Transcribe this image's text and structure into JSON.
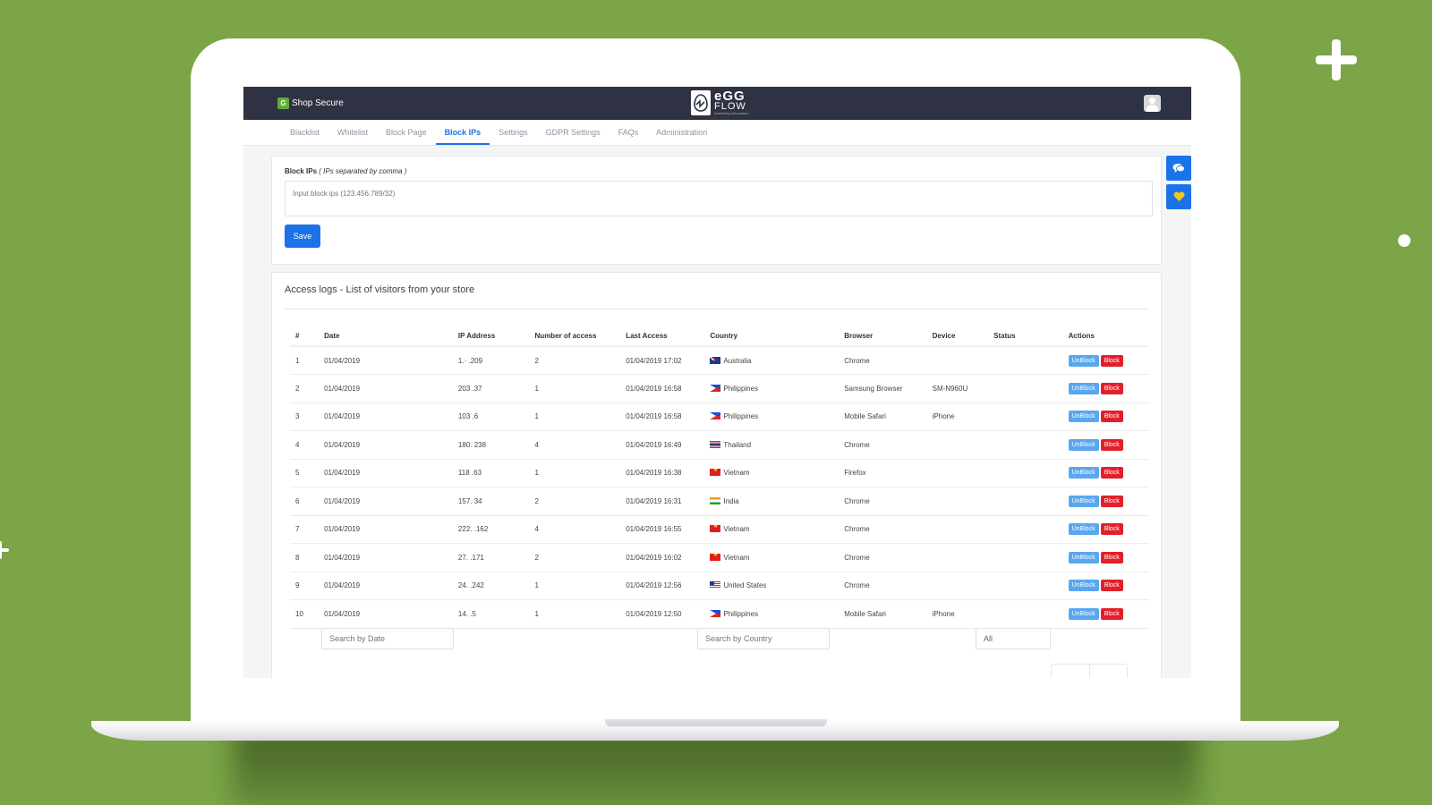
{
  "app": {
    "brand_name": "Shop Secure",
    "brand_icon": "shield-icon",
    "partner_logo": {
      "line1": "eGG",
      "line2": "FLOW",
      "tagline": "marketing automation"
    },
    "user_icon": "user-avatar-icon"
  },
  "tabs": [
    {
      "label": "Blacklist",
      "active": false
    },
    {
      "label": "Whitelist",
      "active": false
    },
    {
      "label": "Block Page",
      "active": false
    },
    {
      "label": "Block IPs",
      "active": true
    },
    {
      "label": "Settings",
      "active": false
    },
    {
      "label": "GDPR Settings",
      "active": false
    },
    {
      "label": "FAQs",
      "active": false
    },
    {
      "label": "Administration",
      "active": false
    }
  ],
  "side_buttons": [
    {
      "icon": "chat-icon"
    },
    {
      "icon": "heart-icon",
      "color": "#f5c518"
    }
  ],
  "block_form": {
    "label": "Block IPs",
    "hint": "( IPs separated by comma )",
    "placeholder": "Input block ips (123.456.789/32)",
    "value": "",
    "save_label": "Save"
  },
  "access_logs": {
    "title": "Access logs - List of visitors from your store",
    "columns": [
      "#",
      "Date",
      "IP Address",
      "Number of access",
      "Last Access",
      "Country",
      "Browser",
      "Device",
      "Status",
      "Actions"
    ],
    "rows": [
      {
        "n": "1",
        "date": "01/04/2019",
        "ip": "1.·      .209",
        "count": "2",
        "last": "01/04/2019 17:02",
        "flag": "au",
        "country": "Australia",
        "browser": "Chrome",
        "device": "",
        "status": ""
      },
      {
        "n": "2",
        "date": "01/04/2019",
        "ip": "203        .37",
        "count": "1",
        "last": "01/04/2019 16:58",
        "flag": "ph",
        "country": "Philippines",
        "browser": "Samsung Browser",
        "device": "SM-N960U",
        "status": ""
      },
      {
        "n": "3",
        "date": "01/04/2019",
        "ip": "103       .6",
        "count": "1",
        "last": "01/04/2019 16:58",
        "flag": "ph",
        "country": "Philippines",
        "browser": "Mobile Safari",
        "device": "iPhone",
        "status": ""
      },
      {
        "n": "4",
        "date": "01/04/2019",
        "ip": "180.        238",
        "count": "4",
        "last": "01/04/2019 16:49",
        "flag": "th",
        "country": "Thailand",
        "browser": "Chrome",
        "device": "",
        "status": ""
      },
      {
        "n": "5",
        "date": "01/04/2019",
        "ip": "118       .63",
        "count": "1",
        "last": "01/04/2019 16:38",
        "flag": "vn",
        "country": "Vietnam",
        "browser": "Firefox",
        "device": "",
        "status": ""
      },
      {
        "n": "6",
        "date": "01/04/2019",
        "ip": "157.       34",
        "count": "2",
        "last": "01/04/2019 16:31",
        "flag": "in",
        "country": "India",
        "browser": "Chrome",
        "device": "",
        "status": ""
      },
      {
        "n": "7",
        "date": "01/04/2019",
        "ip": "222.        .162",
        "count": "4",
        "last": "01/04/2019 16:55",
        "flag": "vn",
        "country": "Vietnam",
        "browser": "Chrome",
        "device": "",
        "status": ""
      },
      {
        "n": "8",
        "date": "01/04/2019",
        "ip": "27.        .171",
        "count": "2",
        "last": "01/04/2019 16:02",
        "flag": "vn",
        "country": "Vietnam",
        "browser": "Chrome",
        "device": "",
        "status": ""
      },
      {
        "n": "9",
        "date": "01/04/2019",
        "ip": "24.       .242",
        "count": "1",
        "last": "01/04/2019 12:56",
        "flag": "us",
        "country": "United States",
        "browser": "Chrome",
        "device": "",
        "status": ""
      },
      {
        "n": "10",
        "date": "01/04/2019",
        "ip": "14.        .5",
        "count": "1",
        "last": "01/04/2019 12:50",
        "flag": "ph",
        "country": "Philippines",
        "browser": "Mobile Safari",
        "device": "iPhone",
        "status": ""
      }
    ],
    "actions": {
      "unblock_label": "UnBlock",
      "block_label": "Block"
    },
    "filters": {
      "date_placeholder": "Search by Date",
      "country_placeholder": "Search by Country",
      "status_value": "All"
    }
  },
  "colors": {
    "background": "#7ba547",
    "topbar": "#2f3242",
    "accent": "#1a73e8",
    "unblock": "#5aa7ee",
    "block": "#e0202a"
  }
}
